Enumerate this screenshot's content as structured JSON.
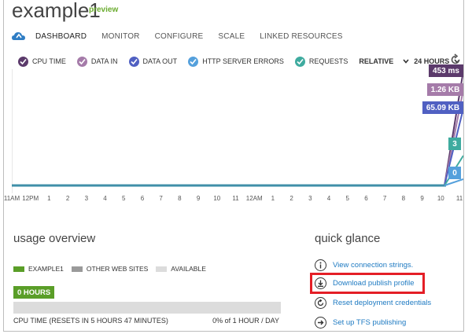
{
  "header": {
    "title": "example1",
    "badge": "preview"
  },
  "nav": {
    "icon": "cloud-icon",
    "tabs": [
      {
        "label": "DASHBOARD",
        "active": true
      },
      {
        "label": "MONITOR"
      },
      {
        "label": "CONFIGURE"
      },
      {
        "label": "SCALE"
      },
      {
        "label": "LINKED RESOURCES"
      }
    ]
  },
  "metrics": {
    "items": [
      {
        "label": "CPU TIME",
        "color": "#5b3a6b"
      },
      {
        "label": "DATA IN",
        "color": "#a57ba9"
      },
      {
        "label": "DATA OUT",
        "color": "#5060c2"
      },
      {
        "label": "HTTP SERVER ERRORS",
        "color": "#54a0dc"
      },
      {
        "label": "REQUESTS",
        "color": "#3fab9f"
      }
    ],
    "mode": "RELATIVE",
    "range": "24 HOURS"
  },
  "chart": {
    "value_labels": [
      {
        "text": "453 ms",
        "color": "#5b3a6b"
      },
      {
        "text": "1.26 KB",
        "color": "#a57ba9"
      },
      {
        "text": "65.09 KB",
        "color": "#5060c2"
      },
      {
        "text": "3",
        "color": "#3fab9f"
      },
      {
        "text": "0",
        "color": "#54a0dc"
      }
    ],
    "x_ticks": [
      "11AM",
      "12PM",
      "1",
      "2",
      "3",
      "4",
      "5",
      "6",
      "7",
      "8",
      "9",
      "10",
      "11",
      "12AM",
      "1",
      "2",
      "3",
      "4",
      "5",
      "6",
      "7",
      "8",
      "9",
      "10",
      "11"
    ],
    "baseline_color": "#3f8fa8"
  },
  "usage": {
    "title": "usage overview",
    "legend": [
      {
        "label": "EXAMPLE1",
        "color": "#5a9e28"
      },
      {
        "label": "OTHER WEB SITES",
        "color": "#9a9a9a"
      },
      {
        "label": "AVAILABLE",
        "color": "#dcdcdc"
      }
    ],
    "hours_label": "0 HOURS",
    "used_fraction": 0.0,
    "cpu_label": "CPU TIME  (RESETS IN 5 HOURS 47 MINUTES)",
    "cpu_pct": "0%",
    "cpu_of": " of 1 HOUR / DAY"
  },
  "quick_glance": {
    "title": "quick glance",
    "items": [
      {
        "label": "View connection strings.",
        "icon": "info-icon"
      },
      {
        "label": "Download publish profile",
        "icon": "download-icon"
      },
      {
        "label": "Reset deployment credentials",
        "icon": "reset-icon"
      },
      {
        "label": "Set up TFS publishing",
        "icon": "arrow-right-icon"
      }
    ]
  }
}
